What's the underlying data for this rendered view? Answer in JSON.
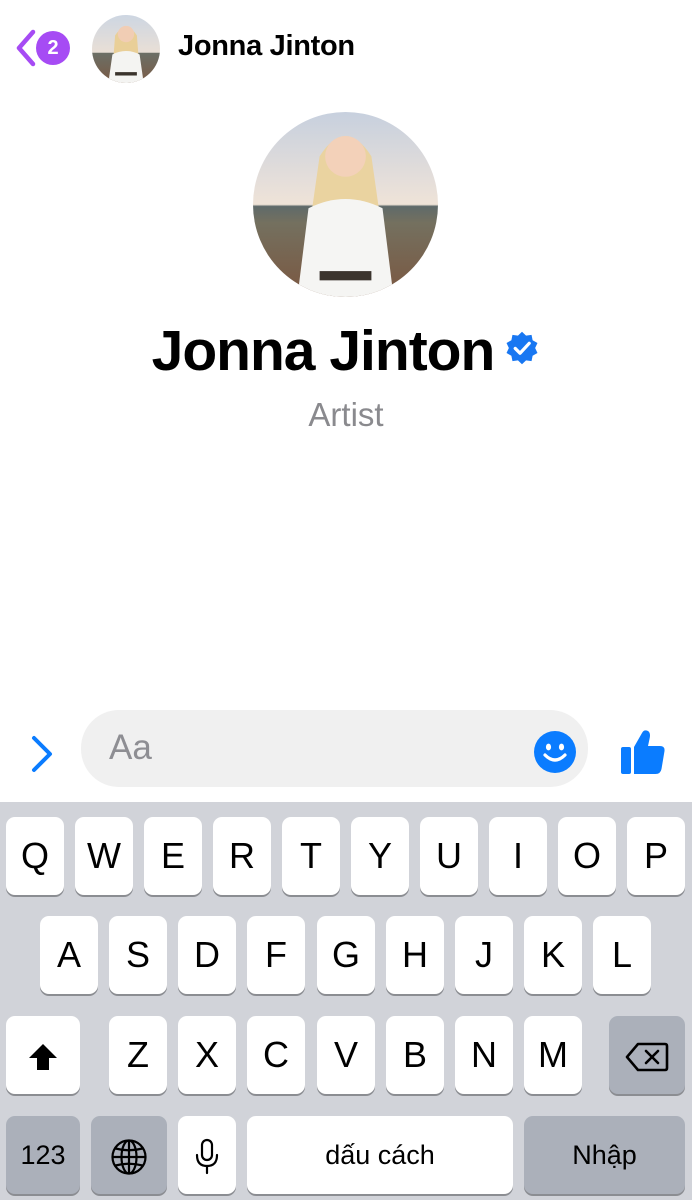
{
  "header": {
    "back_badge_count": "2",
    "contact_name": "Jonna Jinton"
  },
  "profile": {
    "name": "Jonna Jinton",
    "subtitle": "Artist",
    "verified": true
  },
  "composer": {
    "placeholder": "Aa"
  },
  "keyboard": {
    "row1": [
      "Q",
      "W",
      "E",
      "R",
      "T",
      "Y",
      "U",
      "I",
      "O",
      "P"
    ],
    "row2": [
      "A",
      "S",
      "D",
      "F",
      "G",
      "H",
      "J",
      "K",
      "L"
    ],
    "row3": [
      "Z",
      "X",
      "C",
      "V",
      "B",
      "N",
      "M"
    ],
    "numbers_label": "123",
    "space_label": "dấu cách",
    "return_label": "Nhập"
  },
  "colors": {
    "accent_blue": "#0a7cff",
    "badge_purple": "#a64bf4",
    "back_purple": "#a64bf4",
    "keyboard_bg": "#d1d3d9",
    "key_dark": "#abb0ba"
  },
  "icons": {
    "back": "chevron-left-icon",
    "verified": "verified-badge-icon",
    "expand": "chevron-right-icon",
    "emoji": "smiley-icon",
    "like": "thumbs-up-icon",
    "shift": "shift-arrow-icon",
    "backspace": "backspace-icon",
    "globe": "globe-icon",
    "mic": "microphone-icon"
  }
}
